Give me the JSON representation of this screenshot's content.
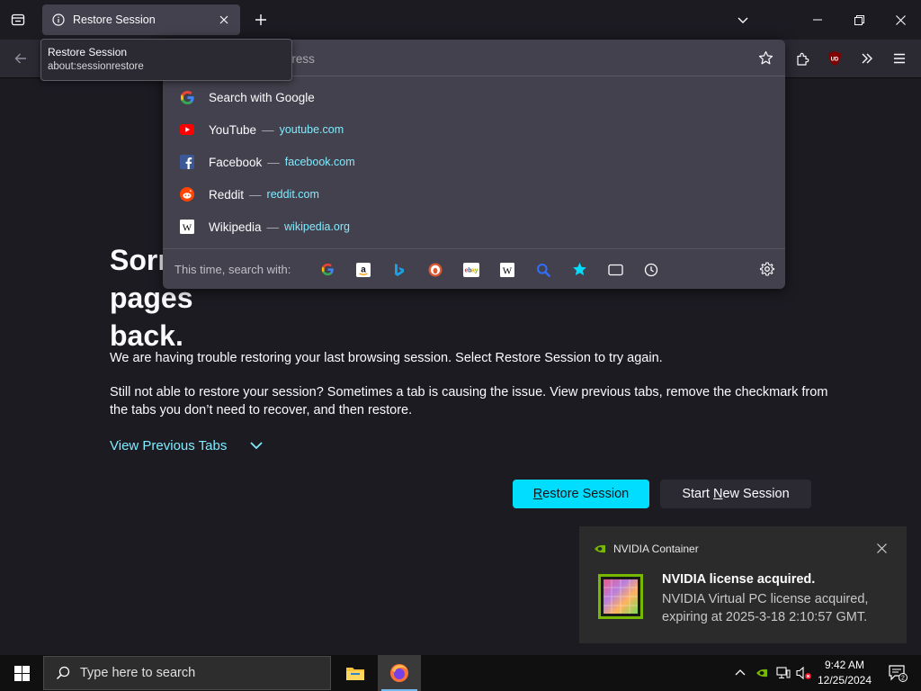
{
  "browser": {
    "tab": {
      "title": "Restore Session",
      "icon": "info-icon"
    },
    "tooltip": {
      "title": "Restore Session",
      "url": "about:sessionrestore"
    },
    "urlbar": {
      "placeholder": "Search or enter address",
      "results": [
        {
          "title": "Search with Google",
          "url": "",
          "icon": "google-icon"
        },
        {
          "title": "YouTube",
          "url": "youtube.com",
          "icon": "youtube-icon"
        },
        {
          "title": "Facebook",
          "url": "facebook.com",
          "icon": "facebook-icon"
        },
        {
          "title": "Reddit",
          "url": "reddit.com",
          "icon": "reddit-icon"
        },
        {
          "title": "Wikipedia",
          "url": "wikipedia.org",
          "icon": "wikipedia-icon"
        }
      ],
      "oneoff_label": "This time, search with:",
      "engines": [
        "google-icon",
        "amazon-icon",
        "bing-icon",
        "duckduckgo-icon",
        "ebay-icon",
        "wikipedia-icon",
        "search-icon",
        "bookmarks-icon",
        "tabs-icon",
        "history-icon"
      ],
      "separator": "—"
    }
  },
  "page": {
    "heading_line1": "Sorry. We’re having trouble getting your pages",
    "heading_line2": "back.",
    "para1": "We are having trouble restoring your last browsing session. Select Restore Session to try again.",
    "para2": "Still not able to restore your session? Sometimes a tab is causing the issue. View previous tabs, remove the checkmark from the tabs you don’t need to recover, and then restore.",
    "view_previous": "View Previous Tabs",
    "restore_pre": "",
    "restore_u": "R",
    "restore_post": "estore Session",
    "new_pre": "Start ",
    "new_u": "N",
    "new_post": "ew Session"
  },
  "toast": {
    "app": "NVIDIA Container",
    "title": "NVIDIA license acquired.",
    "body": "NVIDIA Virtual PC license acquired, expiring at 2025-3-18 2:10:57 GMT."
  },
  "taskbar": {
    "search_placeholder": "Type here to search",
    "time": "9:42 AM",
    "date": "12/25/2024",
    "notification_count": "2"
  },
  "colors": {
    "accent": "#00ddff",
    "link": "#80ebff",
    "page_bg": "#1c1b22",
    "panel_bg": "#42414d"
  }
}
